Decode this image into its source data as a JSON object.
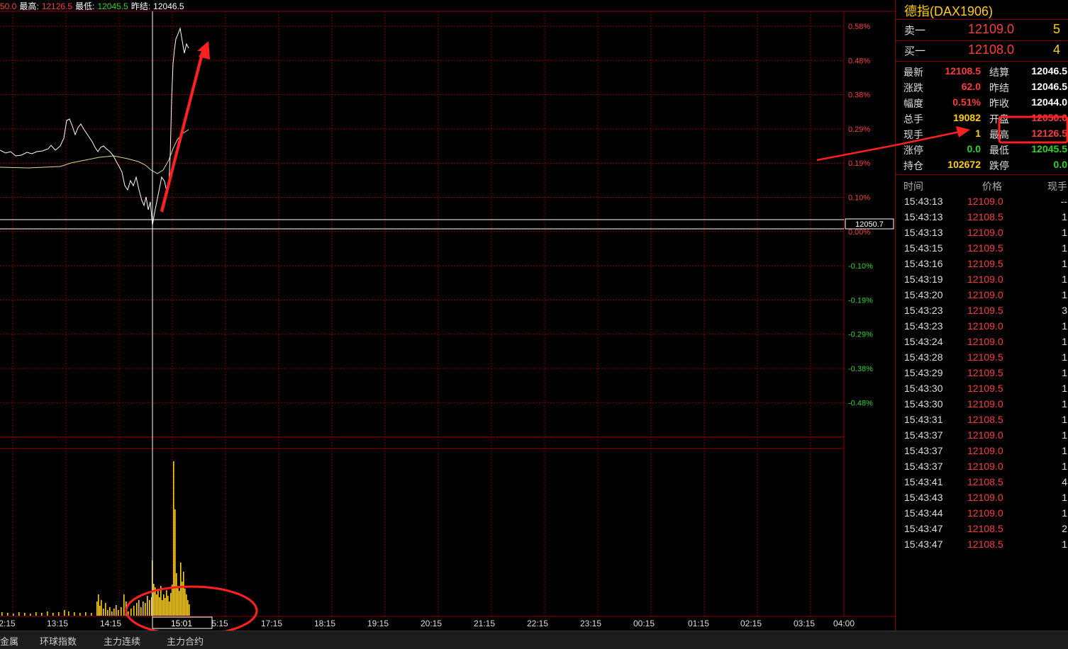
{
  "topbar": {
    "open_frag": "50.0",
    "high_label": "最高:",
    "high_value": "12126.5",
    "low_label": "最低:",
    "low_value": "12045.5",
    "prev_label": "昨结:",
    "prev_value": "12046.5"
  },
  "chart": {
    "pct_labels": [
      "0.58%",
      "0.48%",
      "0.38%",
      "0.29%",
      "0.19%",
      "0.10%",
      "0.00%",
      "-0.10%",
      "-0.19%",
      "-0.29%",
      "-0.38%",
      "-0.48%"
    ],
    "time_labels": [
      "2:15",
      "13:15",
      "14:15",
      "15:01",
      "5:15",
      "17:15",
      "18:15",
      "19:15",
      "20:15",
      "21:15",
      "22:15",
      "23:15",
      "00:15",
      "01:15",
      "02:15",
      "03:15",
      "04:00"
    ],
    "crosshair_price": "12050.7",
    "crosshair_time": "15:01"
  },
  "quote": {
    "title": "德指(DAX1906)",
    "ask": {
      "label": "卖一",
      "price": "12109.0",
      "vol": "5"
    },
    "bid": {
      "label": "买一",
      "price": "12108.0",
      "vol": "4"
    },
    "stats": [
      {
        "l1": "最新",
        "v1": "12108.5",
        "c1": "red",
        "l2": "结算",
        "v2": "12046.5",
        "c2": "white"
      },
      {
        "l1": "涨跌",
        "v1": "62.0",
        "c1": "red",
        "l2": "昨结",
        "v2": "12046.5",
        "c2": "white"
      },
      {
        "l1": "幅度",
        "v1": "0.51%",
        "c1": "red",
        "l2": "昨收",
        "v2": "12044.0",
        "c2": "white"
      },
      {
        "l1": "总手",
        "v1": "19082",
        "c1": "yellow",
        "l2": "开盘",
        "v2": "12050.0",
        "c2": "red"
      },
      {
        "l1": "现手",
        "v1": "1",
        "c1": "yellow",
        "l2": "最高",
        "v2": "12126.5",
        "c2": "red"
      },
      {
        "l1": "涨停",
        "v1": "0.0",
        "c1": "green",
        "l2": "最低",
        "v2": "12045.5",
        "c2": "green"
      },
      {
        "l1": "持仓",
        "v1": "102672",
        "c1": "yellow",
        "l2": "跌停",
        "v2": "0.0",
        "c2": "green"
      }
    ],
    "tick_header": {
      "time": "时间",
      "price": "价格",
      "vol": "现手"
    },
    "ticks": [
      {
        "t": "15:43:13",
        "p": "12109.0",
        "v": "--"
      },
      {
        "t": "15:43:13",
        "p": "12108.5",
        "v": "1"
      },
      {
        "t": "15:43:13",
        "p": "12109.0",
        "v": "1"
      },
      {
        "t": "15:43:15",
        "p": "12109.5",
        "v": "1"
      },
      {
        "t": "15:43:16",
        "p": "12109.5",
        "v": "1"
      },
      {
        "t": "15:43:19",
        "p": "12109.0",
        "v": "1"
      },
      {
        "t": "15:43:20",
        "p": "12109.0",
        "v": "1"
      },
      {
        "t": "15:43:23",
        "p": "12109.5",
        "v": "3"
      },
      {
        "t": "15:43:23",
        "p": "12109.0",
        "v": "1"
      },
      {
        "t": "15:43:24",
        "p": "12109.0",
        "v": "1"
      },
      {
        "t": "15:43:28",
        "p": "12109.5",
        "v": "1"
      },
      {
        "t": "15:43:29",
        "p": "12109.5",
        "v": "1"
      },
      {
        "t": "15:43:30",
        "p": "12109.5",
        "v": "1"
      },
      {
        "t": "15:43:30",
        "p": "12109.0",
        "v": "1"
      },
      {
        "t": "15:43:31",
        "p": "12108.5",
        "v": "1"
      },
      {
        "t": "15:43:37",
        "p": "12109.0",
        "v": "1"
      },
      {
        "t": "15:43:37",
        "p": "12109.0",
        "v": "1"
      },
      {
        "t": "15:43:37",
        "p": "12109.0",
        "v": "1"
      },
      {
        "t": "15:43:41",
        "p": "12108.5",
        "v": "4"
      },
      {
        "t": "15:43:43",
        "p": "12109.0",
        "v": "1"
      },
      {
        "t": "15:43:44",
        "p": "12109.0",
        "v": "1"
      },
      {
        "t": "15:43:47",
        "p": "12108.5",
        "v": "2"
      },
      {
        "t": "15:43:47",
        "p": "12108.5",
        "v": "1"
      }
    ]
  },
  "tabs": [
    "金属",
    "环球指数",
    "主力连续",
    "主力合约"
  ],
  "colors": {
    "grid": "#8b0000",
    "price_line": "#ffffff",
    "avg_line": "#e0d890",
    "volume": "#ffd000",
    "annotation": "#ff2020"
  }
}
